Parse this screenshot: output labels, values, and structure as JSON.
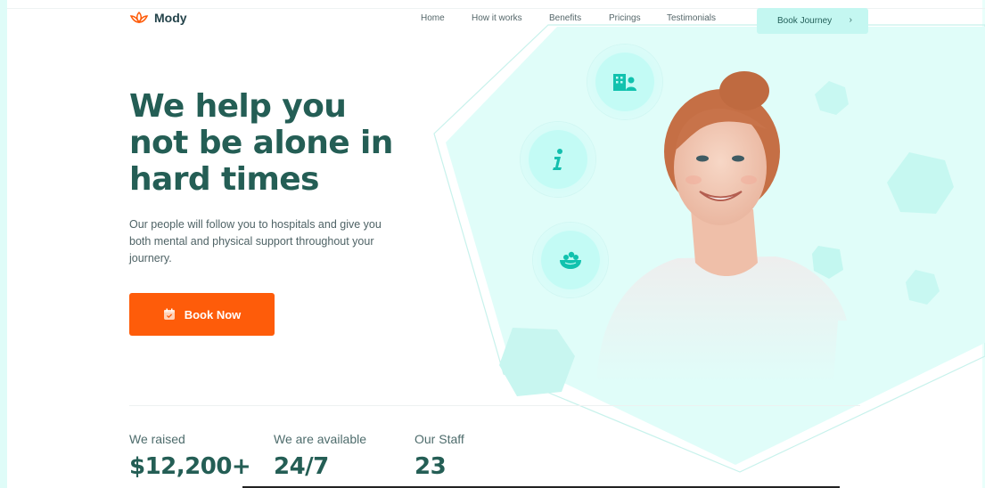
{
  "brand": {
    "name": "Mody",
    "accent": "#fe5c0a",
    "primary": "#245e55",
    "mint": "#c4f7f1"
  },
  "nav": {
    "links": [
      "Home",
      "How it works",
      "Benefits",
      "Pricings",
      "Testimonials"
    ],
    "cta_label": "Book Journey",
    "cta_icon": "chevron-right-icon"
  },
  "hero": {
    "title_lines": [
      "We help you",
      "not be alone in",
      "hard times"
    ],
    "description": "Our people will follow you to hospitals and give you both mental and physical support throughout your journery.",
    "button_label": "Book Now",
    "button_icon": "calendar-icon"
  },
  "features": [
    {
      "icon": "building-people-icon"
    },
    {
      "icon": "info-icon"
    },
    {
      "icon": "food-bowl-icon"
    }
  ],
  "stats": [
    {
      "label": "We raised",
      "value": "$12,200+"
    },
    {
      "label": "We are available",
      "value": "24/7"
    },
    {
      "label": "Our Staff",
      "value": "23"
    }
  ]
}
